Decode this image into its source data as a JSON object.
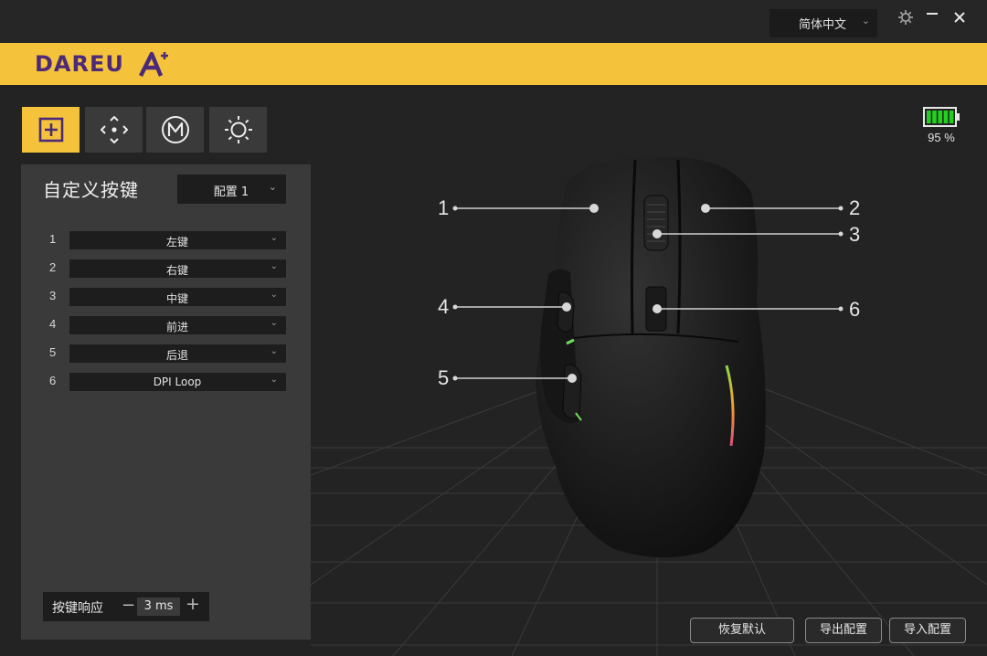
{
  "titlebar": {
    "language": "简体中文",
    "icons": [
      "gear-icon",
      "minimize-icon",
      "close-icon"
    ]
  },
  "brand": {
    "logo_text": "DAREU",
    "colors": {
      "bar": "#f5c33b",
      "logo": "#4c2a78"
    }
  },
  "tabs": [
    {
      "icon": "button-assign-icon",
      "active": true
    },
    {
      "icon": "dpi-arrows-icon",
      "active": false
    },
    {
      "icon": "macro-m-icon",
      "active": false
    },
    {
      "icon": "lighting-sun-icon",
      "active": false
    }
  ],
  "battery": {
    "percent_text": "95 %",
    "level": 0.95,
    "color": "#22d11e"
  },
  "panel": {
    "title": "自定义按键",
    "profile": "配置 1",
    "keys": [
      {
        "num": "1",
        "value": "左键"
      },
      {
        "num": "2",
        "value": "右键"
      },
      {
        "num": "3",
        "value": "中键"
      },
      {
        "num": "4",
        "value": "前进"
      },
      {
        "num": "5",
        "value": "后退"
      },
      {
        "num": "6",
        "value": "DPI Loop"
      }
    ],
    "response": {
      "label": "按键响应",
      "minus": "−",
      "value": "3 ms",
      "plus": "+"
    }
  },
  "callouts": [
    "1",
    "2",
    "3",
    "4",
    "5",
    "6"
  ],
  "footer": {
    "restore": "恢复默认",
    "export": "导出配置",
    "import": "导入配置"
  }
}
